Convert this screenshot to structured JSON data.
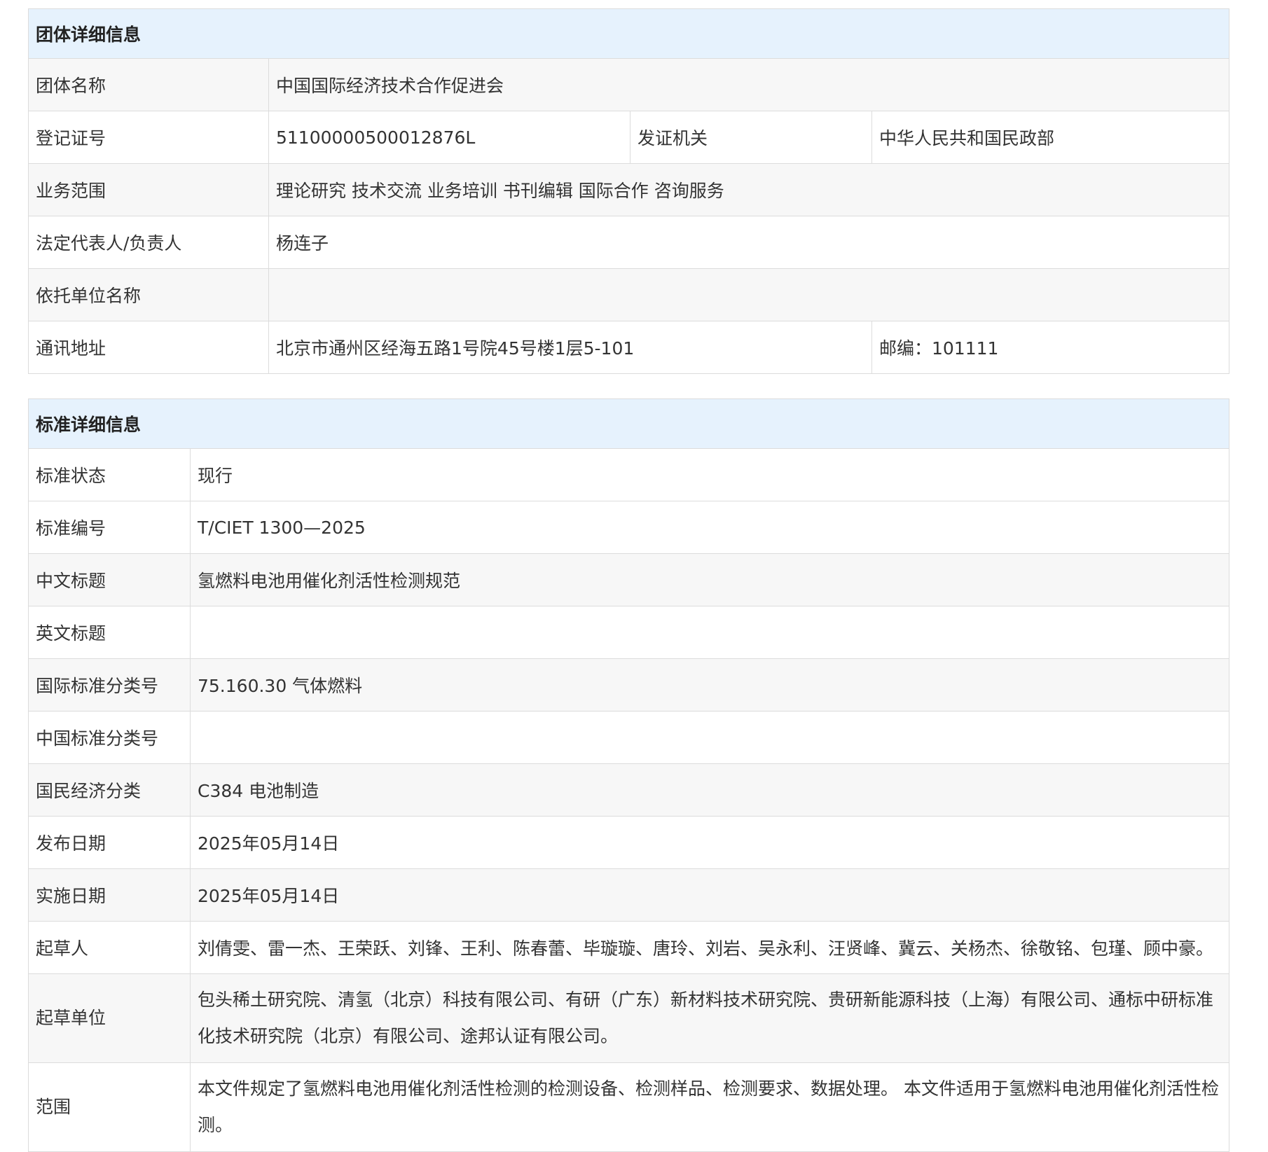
{
  "group": {
    "header": "团体详细信息",
    "rows": {
      "name": {
        "label": "团体名称",
        "value": "中国国际经济技术合作促进会"
      },
      "reg_no": {
        "label": "登记证号",
        "value": "51100000500012876L"
      },
      "issuer": {
        "label": "发证机关",
        "value": "中华人民共和国民政部"
      },
      "scope": {
        "label": "业务范围",
        "value": "理论研究 技术交流 业务培训 书刊编辑 国际合作 咨询服务"
      },
      "legal_rep": {
        "label": "法定代表人/负责人",
        "value": "杨连子"
      },
      "supporting_unit": {
        "label": "依托单位名称",
        "value": ""
      },
      "address": {
        "label": "通讯地址",
        "value": "北京市通州区经海五路1号院45号楼1层5-101"
      },
      "postcode": "邮编：101111"
    }
  },
  "standard": {
    "header": "标准详细信息",
    "rows": [
      {
        "label": "标准状态",
        "value": "现行"
      },
      {
        "label": "标准编号",
        "value": "T/CIET 1300—2025"
      },
      {
        "label": "中文标题",
        "value": "氢燃料电池用催化剂活性检测规范"
      },
      {
        "label": "英文标题",
        "value": ""
      },
      {
        "label": "国际标准分类号",
        "value": "75.160.30 气体燃料"
      },
      {
        "label": "中国标准分类号",
        "value": ""
      },
      {
        "label": "国民经济分类",
        "value": "C384 电池制造"
      },
      {
        "label": "发布日期",
        "value": "2025年05月14日"
      },
      {
        "label": "实施日期",
        "value": "2025年05月14日"
      },
      {
        "label": "起草人",
        "value": "刘倩雯、雷一杰、王荣跃、刘锋、王利、陈春蕾、毕璇璇、唐玲、刘岩、吴永利、汪贤峰、冀云、关杨杰、徐敬铭、包瑾、顾中豪。"
      },
      {
        "label": "起草单位",
        "value": "包头稀土研究院、清氢（北京）科技有限公司、有研（广东）新材料技术研究院、贵研新能源科技（上海）有限公司、通标中研标准化技术研究院（北京）有限公司、途邦认证有限公司。"
      },
      {
        "label": "范围",
        "value": "本文件规定了氢燃料电池用催化剂活性检测的检测设备、检测样品、检测要求、数据处理。 本文件适用于氢燃料电池用催化剂活性检测。"
      }
    ]
  }
}
